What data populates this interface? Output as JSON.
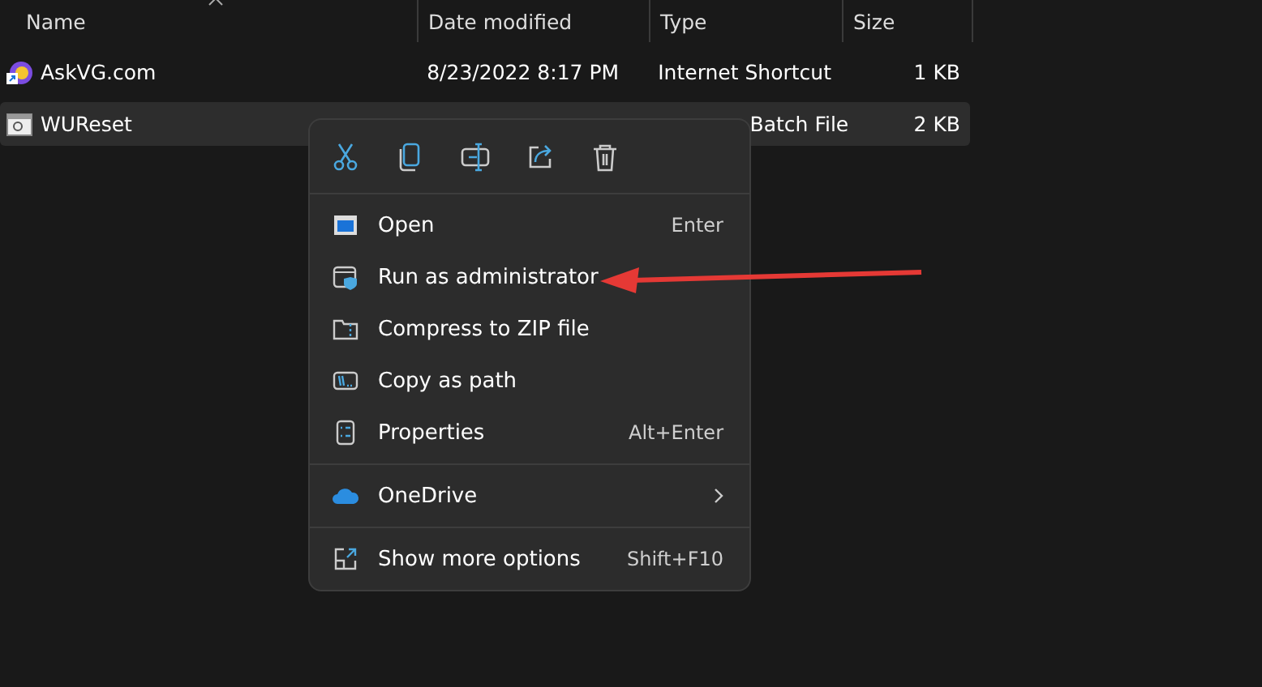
{
  "columns": [
    {
      "label": "Name",
      "sorted": true
    },
    {
      "label": "Date modified",
      "sorted": false
    },
    {
      "label": "Type",
      "sorted": false
    },
    {
      "label": "Size",
      "sorted": false
    }
  ],
  "files": [
    {
      "kind": "web",
      "name": "AskVG.com",
      "date": "8/23/2022 8:17 PM",
      "type": "Internet Shortcut",
      "size": "1 KB",
      "selected": false
    },
    {
      "kind": "batch",
      "name": "WUReset",
      "type_visible": "Batch File",
      "size": "2 KB",
      "selected": true
    }
  ],
  "context_menu": {
    "quick_actions": [
      {
        "kind": "cut"
      },
      {
        "kind": "copy"
      },
      {
        "kind": "rename"
      },
      {
        "kind": "share"
      },
      {
        "kind": "delete"
      }
    ],
    "groups": [
      [
        {
          "kind": "open",
          "label": "Open",
          "shortcut": "Enter",
          "submenu": false
        },
        {
          "kind": "admin",
          "label": "Run as administrator",
          "submenu": false
        },
        {
          "kind": "zip",
          "label": "Compress to ZIP file",
          "submenu": false
        },
        {
          "kind": "path",
          "label": "Copy as path",
          "submenu": false
        },
        {
          "kind": "props",
          "label": "Properties",
          "shortcut": "Alt+Enter",
          "submenu": false
        }
      ],
      [
        {
          "kind": "cloud",
          "label": "OneDrive",
          "submenu": true
        }
      ],
      [
        {
          "kind": "more",
          "label": "Show more options",
          "shortcut": "Shift+F10",
          "submenu": false
        }
      ]
    ]
  },
  "annotation": {
    "kind": "arrow",
    "color": "#e53935"
  }
}
